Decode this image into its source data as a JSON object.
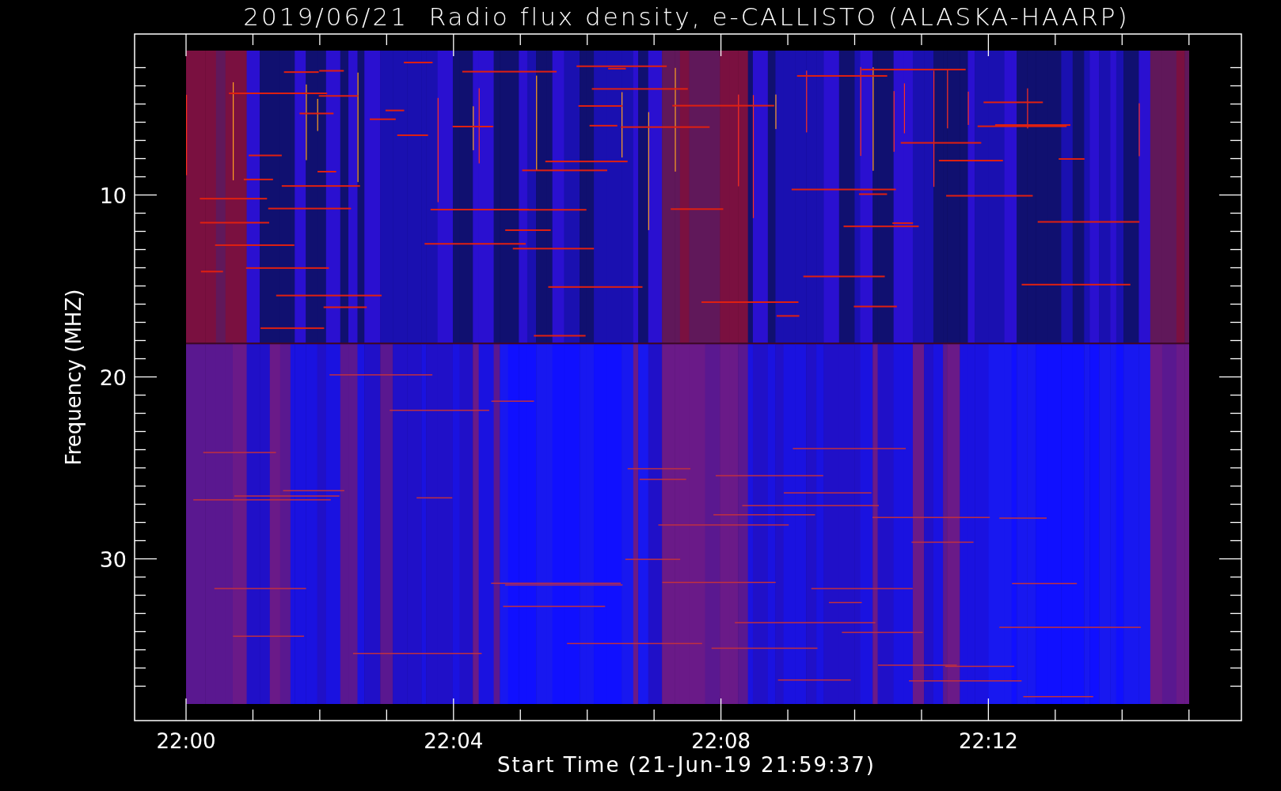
{
  "title": "2019/06/21  Radio flux density, e-CALLISTO (ALASKA-HAARP)",
  "y_axis": {
    "label": "Frequency (MHZ)",
    "ticks": [
      "10",
      "20",
      "30"
    ]
  },
  "x_axis": {
    "label": "Start Time (21-Jun-19 21:59:37)",
    "ticks": [
      "22:00",
      "22:04",
      "22:08",
      "22:12"
    ]
  }
}
